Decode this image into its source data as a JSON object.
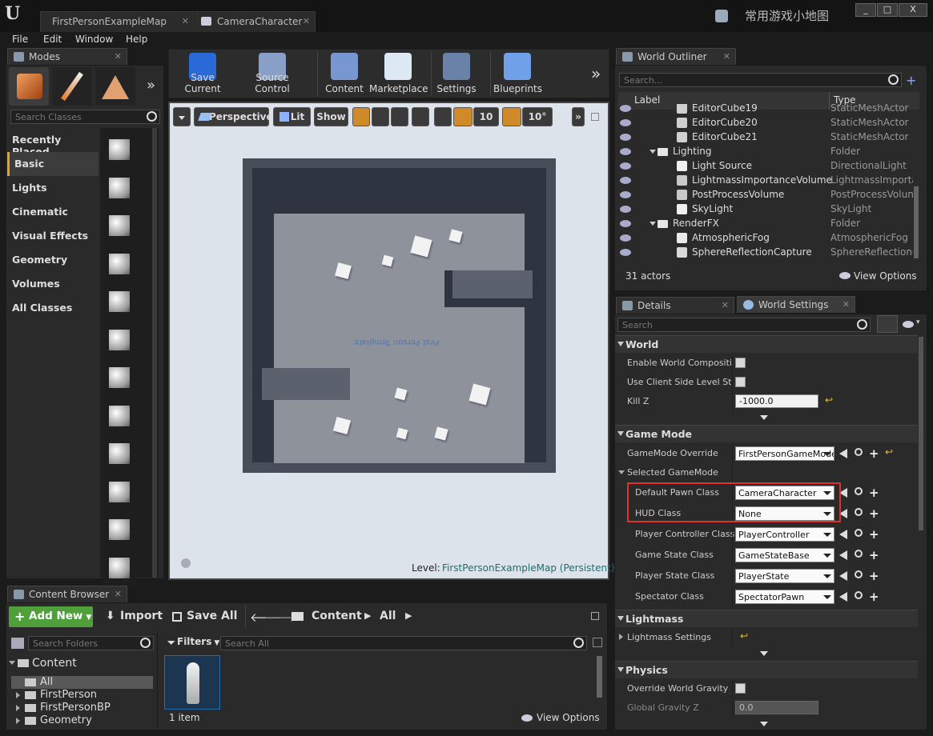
{
  "window": {
    "tabs": [
      {
        "label": "FirstPersonExampleMap"
      },
      {
        "label": "CameraCharacter"
      }
    ],
    "watermark": "常用游戏小地图",
    "buttons": [
      "_",
      "□",
      "X"
    ]
  },
  "menu": [
    "File",
    "Edit",
    "Window",
    "Help"
  ],
  "modes": {
    "tab_label": "Modes",
    "search_placeholder": "Search Classes",
    "categories": [
      "Recently Placed",
      "Basic",
      "Lights",
      "Cinematic",
      "Visual Effects",
      "Geometry",
      "Volumes",
      "All Classes"
    ],
    "selected_category": "Basic",
    "thumb_icons": [
      "sphere-icon",
      "character-icon",
      "pawn-icon",
      "point-light-icon",
      "player-start-icon",
      "cube-icon",
      "sphere-icon",
      "cylinder-icon",
      "cone-icon",
      "plane-icon",
      "trigger-box-icon",
      "trigger-sphere-icon"
    ]
  },
  "toolbar": {
    "buttons": [
      {
        "label": "Save Current",
        "icon": "save-icon"
      },
      {
        "label": "Source Control",
        "icon": "source-control-icon"
      },
      {
        "label": "Content",
        "icon": "content-icon"
      },
      {
        "label": "Marketplace",
        "icon": "marketplace-icon"
      },
      {
        "label": "Settings",
        "icon": "settings-icon"
      },
      {
        "label": "Blueprints",
        "icon": "blueprints-icon"
      }
    ]
  },
  "viewport": {
    "perspective": "Perspective",
    "lit": "Lit",
    "show": "Show",
    "grid_snap": "10",
    "rot_snap": "10°",
    "floor_text": "First Person Template",
    "level_label": "Level:",
    "level_name": "FirstPersonExampleMap (Persistent)"
  },
  "outliner": {
    "tab_label": "World Outliner",
    "search_placeholder": "Search...",
    "col_label": "Label",
    "col_type": "Type",
    "rows": [
      {
        "name": "EditorCube19",
        "type": "StaticMeshActor",
        "indent": 2,
        "kind": "mesh"
      },
      {
        "name": "EditorCube20",
        "type": "StaticMeshActor",
        "indent": 2,
        "kind": "mesh"
      },
      {
        "name": "EditorCube21",
        "type": "StaticMeshActor",
        "indent": 2,
        "kind": "mesh"
      },
      {
        "name": "Lighting",
        "type": "Folder",
        "indent": 1,
        "kind": "folder"
      },
      {
        "name": "Light Source",
        "type": "DirectionalLight",
        "indent": 2,
        "kind": "light"
      },
      {
        "name": "LightmassImportanceVolume",
        "type": "LightmassImporta",
        "indent": 2,
        "kind": "volume"
      },
      {
        "name": "PostProcessVolume",
        "type": "PostProcessVolun",
        "indent": 2,
        "kind": "volume"
      },
      {
        "name": "SkyLight",
        "type": "SkyLight",
        "indent": 2,
        "kind": "light"
      },
      {
        "name": "RenderFX",
        "type": "Folder",
        "indent": 1,
        "kind": "folder"
      },
      {
        "name": "AtmosphericFog",
        "type": "AtmosphericFog",
        "indent": 2,
        "kind": "fog"
      },
      {
        "name": "SphereReflectionCapture",
        "type": "SphereReflectionC",
        "indent": 2,
        "kind": "capture"
      }
    ],
    "actor_count": "31 actors",
    "view_options": "View Options"
  },
  "details": {
    "tab_details": "Details",
    "tab_world_settings": "World Settings",
    "search_placeholder": "Search",
    "sections": {
      "world": "World",
      "game_mode": "Game Mode",
      "lightmass": "Lightmass",
      "physics": "Physics"
    },
    "world": {
      "enable_world_composition": "Enable World Composition",
      "use_client_side": "Use Client Side Level Stre",
      "kill_z_label": "Kill Z",
      "kill_z_value": "-1000.0"
    },
    "game_mode": {
      "override_label": "GameMode Override",
      "override_value": "FirstPersonGameMode",
      "selected_label": "Selected GameMode",
      "rows": [
        {
          "label": "Default Pawn Class",
          "value": "CameraCharacter"
        },
        {
          "label": "HUD Class",
          "value": "None"
        },
        {
          "label": "Player Controller Class",
          "value": "PlayerController"
        },
        {
          "label": "Game State Class",
          "value": "GameStateBase"
        },
        {
          "label": "Player State Class",
          "value": "PlayerState"
        },
        {
          "label": "Spectator Class",
          "value": "SpectatorPawn"
        }
      ]
    },
    "lightmass": {
      "settings_label": "Lightmass Settings"
    },
    "physics": {
      "override_gravity": "Override World Gravity",
      "global_gravity_label": "Global Gravity Z",
      "global_gravity_value": "0.0"
    }
  },
  "content_browser": {
    "tab_label": "Content Browser",
    "add_new": "Add New",
    "import": "Import",
    "save_all": "Save All",
    "path": [
      "Content",
      "All"
    ],
    "search_folders": "Search Folders",
    "filters": "Filters",
    "search_all": "Search All",
    "tree": [
      {
        "label": "Content",
        "level": 0
      },
      {
        "label": "All",
        "level": 1
      },
      {
        "label": "FirstPerson",
        "level": 1
      },
      {
        "label": "FirstPersonBP",
        "level": 1
      },
      {
        "label": "Geometry",
        "level": 1
      }
    ],
    "item_count": "1 item",
    "view_options": "View Options"
  }
}
